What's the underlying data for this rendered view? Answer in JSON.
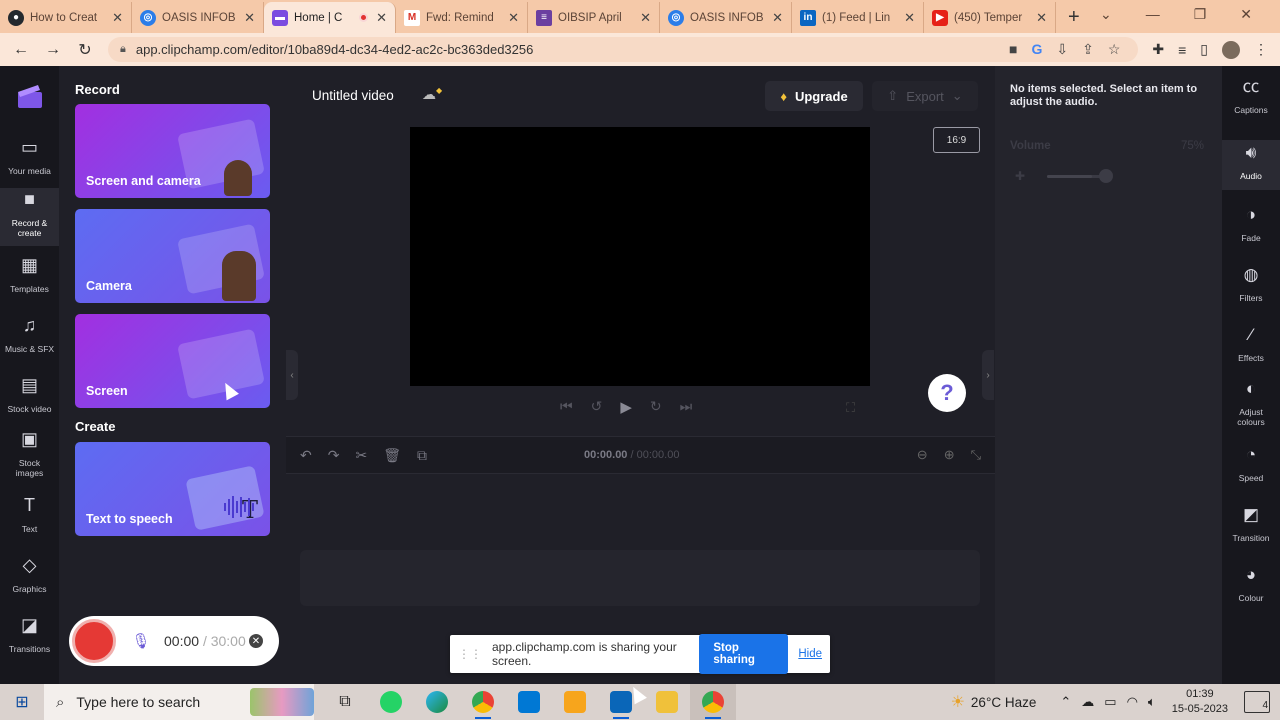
{
  "browser": {
    "tabs": [
      {
        "title": "How to Creat",
        "icon": "github-icon",
        "color": "#24292e",
        "active": false
      },
      {
        "title": "OASIS INFOB",
        "icon": "oasis-icon",
        "color": "#2b7de9",
        "active": false
      },
      {
        "title": "Home | C",
        "icon": "clipchamp-icon",
        "color": "#7b4ce0",
        "active": true,
        "recording": true
      },
      {
        "title": "Fwd: Remind",
        "icon": "gmail-icon",
        "color": "#d93025",
        "active": false
      },
      {
        "title": "OIBSIP April",
        "icon": "forms-icon",
        "color": "#6b3fa0",
        "active": false
      },
      {
        "title": "OASIS INFOB",
        "icon": "oasis-icon",
        "color": "#2b7de9",
        "active": false
      },
      {
        "title": "(1) Feed | Lin",
        "icon": "linkedin-icon",
        "color": "#0a66c2",
        "active": false
      },
      {
        "title": "(450) Temper",
        "icon": "youtube-icon",
        "color": "#e62117",
        "active": false
      }
    ],
    "url": "app.clipchamp.com/editor/10ba89d4-dc34-4ed2-ac2c-bc363ded3256"
  },
  "leftnav": {
    "items": [
      {
        "label": "Your media",
        "icon": "folder-icon",
        "active": false
      },
      {
        "label": "Record & create",
        "icon": "video-camera-icon",
        "active": true
      },
      {
        "label": "Templates",
        "icon": "templates-icon",
        "active": false
      },
      {
        "label": "Music & SFX",
        "icon": "music-icon",
        "active": false
      },
      {
        "label": "Stock video",
        "icon": "film-icon",
        "active": false
      },
      {
        "label": "Stock images",
        "icon": "image-icon",
        "active": false
      },
      {
        "label": "Text",
        "icon": "text-icon",
        "active": false
      },
      {
        "label": "Graphics",
        "icon": "shapes-icon",
        "active": false
      },
      {
        "label": "Transitions",
        "icon": "transitions-icon",
        "active": false
      }
    ]
  },
  "record_panel": {
    "record_title": "Record",
    "create_title": "Create",
    "cards": {
      "screen_camera": "Screen and camera",
      "camera": "Camera",
      "screen": "Screen",
      "tts": "Text to speech"
    },
    "recorder": {
      "elapsed": "00:00",
      "limit": "30:00",
      "separator": "/"
    }
  },
  "editor": {
    "project_title": "Untitled video",
    "upgrade_label": "Upgrade",
    "export_label": "Export",
    "aspect_ratio": "16:9",
    "help_label": "?",
    "time_current": "00:00.00",
    "time_total": "/ 00:00.00"
  },
  "audio_panel": {
    "message": "No items selected. Select an item to adjust the audio.",
    "volume_label": "Volume",
    "volume_value": "75%",
    "volume_level": 0.75
  },
  "rightnav": {
    "items": [
      {
        "label": "Captions",
        "icon": "captions-icon",
        "active": false
      },
      {
        "label": "Audio",
        "icon": "speaker-icon",
        "active": true
      },
      {
        "label": "Fade",
        "icon": "fade-icon",
        "active": false
      },
      {
        "label": "Filters",
        "icon": "filters-icon",
        "active": false
      },
      {
        "label": "Effects",
        "icon": "magic-wand-icon",
        "active": false
      },
      {
        "label": "Adjust colours",
        "icon": "contrast-icon",
        "active": false
      },
      {
        "label": "Speed",
        "icon": "speedometer-icon",
        "active": false
      },
      {
        "label": "Transition",
        "icon": "transition-icon",
        "active": false
      },
      {
        "label": "Colour",
        "icon": "palette-icon",
        "active": false
      }
    ]
  },
  "share_banner": {
    "message": "app.clipchamp.com is sharing your screen.",
    "stop_label": "Stop sharing",
    "hide_label": "Hide"
  },
  "taskbar": {
    "search_placeholder": "Type here to search",
    "weather": "26°C  Haze",
    "time": "01:39",
    "date": "15-05-2023",
    "notifications": "4"
  }
}
